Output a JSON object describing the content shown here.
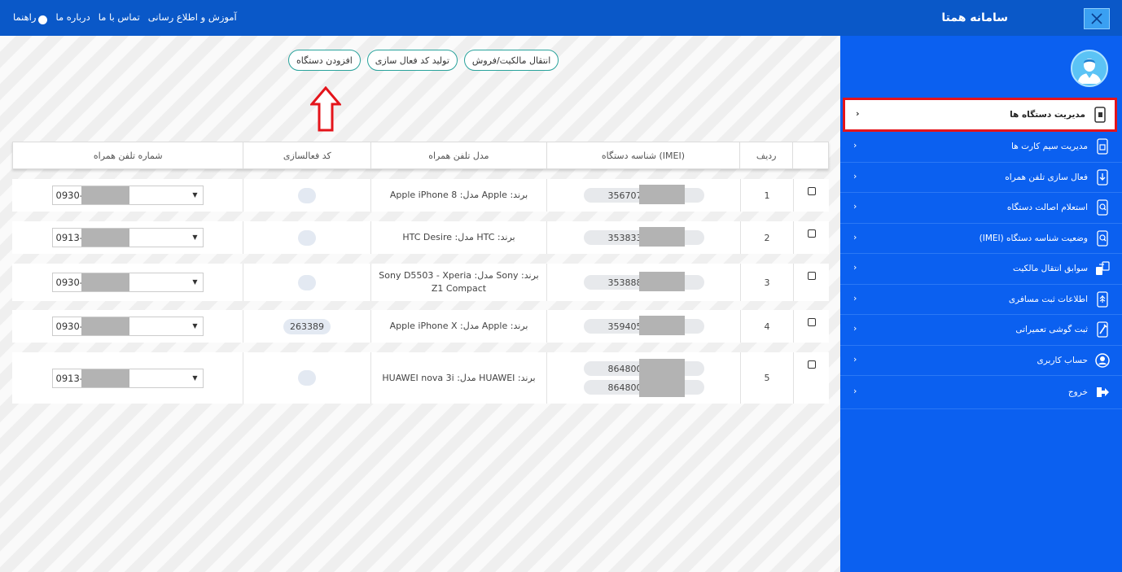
{
  "header": {
    "brand": "سامانه همتا",
    "close_icon": "close-icon",
    "links": [
      "راهنما",
      "درباره ما",
      "تماس با ما",
      "آموزش و اطلاع رسانی"
    ]
  },
  "actions": {
    "add_device": "افزودن دستگاه",
    "generate_code": "تولید کد فعال سازی",
    "transfer": "انتقال مالکیت/فروش"
  },
  "table": {
    "headers": {
      "row": "ردیف",
      "imei": "شناسه دستگاه (IMEI)",
      "model": "مدل تلفن همراه",
      "code": "کد فعالسازی",
      "phone": "شماره تلفن همراه"
    },
    "rows": [
      {
        "row": "1",
        "imei": [
          "356707"
        ],
        "model": "برند: Apple مدل: Apple iPhone 8",
        "code": "",
        "phone": "0930-"
      },
      {
        "row": "2",
        "imei": [
          "353833"
        ],
        "model": "برند: HTC مدل: HTC Desire",
        "code": "",
        "phone": "0913-"
      },
      {
        "row": "3",
        "imei": [
          "353888"
        ],
        "model": "برند: Sony مدل: Sony D5503 - Xperia Z1 Compact",
        "code": "",
        "phone": "0930-"
      },
      {
        "row": "4",
        "imei": [
          "359405"
        ],
        "model": "برند: Apple مدل: Apple iPhone X",
        "code": "263389",
        "phone": "0930-"
      },
      {
        "row": "5",
        "imei": [
          "864800",
          "864800"
        ],
        "model": "برند: HUAWEI مدل: HUAWEI nova 3i",
        "code": "",
        "phone": "0913-"
      }
    ]
  },
  "sidebar": {
    "items": [
      {
        "label": "مدیریت دستگاه ها",
        "icon": "device-icon",
        "active": true
      },
      {
        "label": "مدیریت سیم کارت ها",
        "icon": "sim-card-icon"
      },
      {
        "label": "فعال سازی تلفن همراه",
        "icon": "phone-activate-icon"
      },
      {
        "label": "استعلام اصالت دستگاه",
        "icon": "phone-search-icon"
      },
      {
        "label": "وضعیت شناسه دستگاه (IMEI)",
        "icon": "imei-status-icon"
      },
      {
        "label": "سوابق انتقال مالکیت",
        "icon": "transfer-history-icon"
      },
      {
        "label": "اطلاعات ثبت مسافری",
        "icon": "travel-icon"
      },
      {
        "label": "ثبت گوشی تعمیراتی",
        "icon": "repair-icon"
      },
      {
        "label": "حساب کاربری",
        "icon": "user-account-icon"
      },
      {
        "label": "خروج",
        "icon": "logout-icon"
      }
    ]
  },
  "colors": {
    "topbar": "#0a58c8",
    "sidebar": "#0b60f0",
    "active_border": "#e4141b",
    "button_border": "#2aa39c",
    "arrow": "#e4141b"
  }
}
